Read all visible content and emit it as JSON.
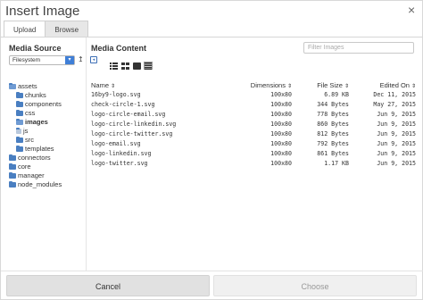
{
  "window": {
    "title": "Insert Image",
    "close_glyph": "×"
  },
  "tabs": [
    {
      "label": "Upload",
      "active": true
    },
    {
      "label": "Browse",
      "active": false
    }
  ],
  "media_source": {
    "title": "Media Source",
    "selected": "Filesystem",
    "select_arrow": "▾",
    "upload_glyph": "↥",
    "tree": [
      {
        "label": "assets",
        "depth": 0,
        "icon": "folder-open-icon",
        "bold": false
      },
      {
        "label": "chunks",
        "depth": 1,
        "icon": "folder-icon",
        "bold": false
      },
      {
        "label": "components",
        "depth": 1,
        "icon": "folder-icon",
        "bold": false
      },
      {
        "label": "css",
        "depth": 1,
        "icon": "folder-icon",
        "bold": false
      },
      {
        "label": "images",
        "depth": 1,
        "icon": "folder-open-icon",
        "bold": true
      },
      {
        "label": "js",
        "depth": 1,
        "icon": "file-icon",
        "bold": false
      },
      {
        "label": "src",
        "depth": 1,
        "icon": "folder-icon",
        "bold": false
      },
      {
        "label": "templates",
        "depth": 1,
        "icon": "folder-icon",
        "bold": false
      },
      {
        "label": "connectors",
        "depth": 0,
        "icon": "folder-icon",
        "bold": false
      },
      {
        "label": "core",
        "depth": 0,
        "icon": "folder-icon",
        "bold": false
      },
      {
        "label": "manager",
        "depth": 0,
        "icon": "folder-icon",
        "bold": false
      },
      {
        "label": "node_modules",
        "depth": 0,
        "icon": "folder-icon",
        "bold": false
      }
    ]
  },
  "media_content": {
    "title": "Media Content",
    "filter_placeholder": "Filter Images",
    "columns": {
      "name": "Name",
      "dimensions": "Dimensions",
      "size": "File Size",
      "date": "Edited On"
    },
    "rows": [
      {
        "name": "16by9-logo.svg",
        "dimensions": "100x80",
        "size": "6.89 KB",
        "date": "Dec 11, 2015"
      },
      {
        "name": "check-circle-1.svg",
        "dimensions": "100x80",
        "size": "344 Bytes",
        "date": "May 27, 2015"
      },
      {
        "name": "logo-circle-email.svg",
        "dimensions": "100x80",
        "size": "778 Bytes",
        "date": "Jun 9, 2015"
      },
      {
        "name": "logo-circle-linkedin.svg",
        "dimensions": "100x80",
        "size": "860 Bytes",
        "date": "Jun 9, 2015"
      },
      {
        "name": "logo-circle-twitter.svg",
        "dimensions": "100x80",
        "size": "812 Bytes",
        "date": "Jun 9, 2015"
      },
      {
        "name": "logo-email.svg",
        "dimensions": "100x80",
        "size": "792 Bytes",
        "date": "Jun 9, 2015"
      },
      {
        "name": "logo-linkedin.svg",
        "dimensions": "100x80",
        "size": "861 Bytes",
        "date": "Jun 9, 2015"
      },
      {
        "name": "logo-twitter.svg",
        "dimensions": "100x80",
        "size": "1.17 KB",
        "date": "Jun 9, 2015"
      }
    ]
  },
  "footer": {
    "cancel_label": "Cancel",
    "choose_label": "Choose"
  },
  "colors": {
    "accent": "#3f7fd7",
    "folder": "#4a7fc1"
  }
}
